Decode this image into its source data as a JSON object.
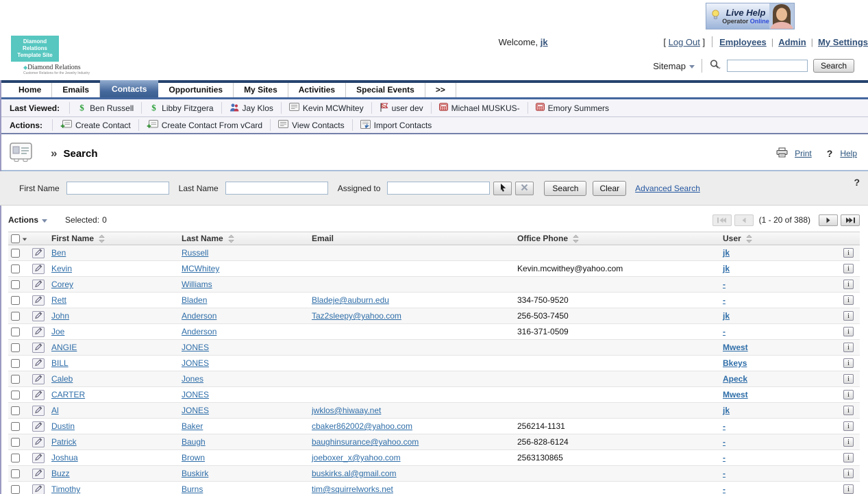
{
  "header": {
    "logo": {
      "line1": "Diamond Relations",
      "line2": "Template Site",
      "brand": "Diamond Relations",
      "tagline": "Customer Relations for the Jewelry Industry"
    },
    "live_help": {
      "title": "Live Help",
      "operator": "Operator",
      "status": "Online"
    },
    "welcome": {
      "prefix": "Welcome,",
      "user": "jk",
      "bracket_open": "[",
      "logout": "Log Out",
      "bracket_close": "]"
    },
    "links": [
      {
        "label": "Employees"
      },
      {
        "label": "Admin"
      },
      {
        "label": "My Settings"
      }
    ],
    "sitemap_label": "Sitemap",
    "site_search": {
      "value": "",
      "placeholder": "",
      "button": "Search"
    }
  },
  "nav": {
    "tabs": [
      {
        "label": "Home",
        "active": false
      },
      {
        "label": "Emails",
        "active": false
      },
      {
        "label": "Contacts",
        "active": true
      },
      {
        "label": "Opportunities",
        "active": false
      },
      {
        "label": "My Sites",
        "active": false
      },
      {
        "label": "Activities",
        "active": false
      },
      {
        "label": "Special Events",
        "active": false
      },
      {
        "label": ">>",
        "active": false
      }
    ]
  },
  "last_viewed": {
    "label": "Last Viewed:",
    "items": [
      {
        "label": "Ben Russell",
        "icon": "sugar-s-icon"
      },
      {
        "label": "Libby Fitzgera",
        "icon": "sugar-s-icon"
      },
      {
        "label": "Jay Klos",
        "icon": "people-icon"
      },
      {
        "label": "Kevin MCWhitey",
        "icon": "note-icon"
      },
      {
        "label": "user dev",
        "icon": "flag-icon"
      },
      {
        "label": "Michael MUSKUS-",
        "icon": "phone-icon"
      },
      {
        "label": "Emory Summers",
        "icon": "phone-icon"
      }
    ]
  },
  "actions_bar": {
    "label": "Actions:",
    "items": [
      {
        "label": "Create Contact",
        "icon": "card-plus-icon"
      },
      {
        "label": "Create Contact From vCard",
        "icon": "card-plus-icon"
      },
      {
        "label": "View Contacts",
        "icon": "note-icon"
      },
      {
        "label": "Import Contacts",
        "icon": "import-icon"
      }
    ]
  },
  "module": {
    "chevrons": "»",
    "title": "Search",
    "print_label": "Print",
    "help_label": "Help",
    "help_mark": "?"
  },
  "search_form": {
    "first_name_label": "First Name",
    "first_name_value": "",
    "last_name_label": "Last Name",
    "last_name_value": "",
    "assigned_to_label": "Assigned to",
    "assigned_to_value": "",
    "search_button": "Search",
    "clear_button": "Clear",
    "advanced_link": "Advanced Search",
    "help_mark": "?"
  },
  "list": {
    "actions_label": "Actions",
    "selected_label": "Selected:",
    "selected_count": "0",
    "pagination_text": "(1 - 20 of 388)"
  },
  "table": {
    "columns": [
      {
        "label": "First Name",
        "sortable": true
      },
      {
        "label": "Last Name",
        "sortable": true
      },
      {
        "label": "Email",
        "sortable": false
      },
      {
        "label": "Office Phone",
        "sortable": true
      },
      {
        "label": "User",
        "sortable": true
      }
    ],
    "rows": [
      {
        "first": "Ben",
        "last": "Russell",
        "email": "",
        "phone": "",
        "user": "jk"
      },
      {
        "first": "Kevin",
        "last": "MCWhitey",
        "email": "",
        "phone": "Kevin.mcwithey@yahoo.com",
        "user": "jk"
      },
      {
        "first": "Corey",
        "last": "Williams",
        "email": "",
        "phone": "",
        "user": "-"
      },
      {
        "first": "Rett",
        "last": "Bladen",
        "email": "Bladeje@auburn.edu",
        "phone": "334-750-9520",
        "user": "-"
      },
      {
        "first": "John",
        "last": "Anderson",
        "email": "Taz2sleepy@yahoo.com",
        "phone": "256-503-7450",
        "user": "jk"
      },
      {
        "first": "Joe",
        "last": "Anderson",
        "email": "",
        "phone": "316-371-0509",
        "user": "-"
      },
      {
        "first": "ANGIE",
        "last": "JONES",
        "email": "",
        "phone": "",
        "user": "Mwest"
      },
      {
        "first": "BILL",
        "last": "JONES",
        "email": "",
        "phone": "",
        "user": "Bkeys"
      },
      {
        "first": "Caleb",
        "last": "Jones",
        "email": "",
        "phone": "",
        "user": "Apeck"
      },
      {
        "first": "CARTER",
        "last": "JONES",
        "email": "",
        "phone": "",
        "user": "Mwest"
      },
      {
        "first": "Al",
        "last": "JONES",
        "email": "jwklos@hiwaay.net",
        "phone": "",
        "user": "jk"
      },
      {
        "first": "Dustin",
        "last": "Baker",
        "email": "cbaker862002@yahoo.com",
        "phone": "256214-1131",
        "user": "-"
      },
      {
        "first": "Patrick",
        "last": "Baugh",
        "email": "baughinsurance@yahoo.com",
        "phone": "256-828-6124",
        "user": "-"
      },
      {
        "first": "Joshua",
        "last": "Brown",
        "email": "joeboxer_x@yahoo.com",
        "phone": "2563130865",
        "user": "-"
      },
      {
        "first": "Buzz",
        "last": "Buskirk",
        "email": "buskirks.al@gmail.com",
        "phone": "",
        "user": "-"
      },
      {
        "first": "Timothy",
        "last": "Burns",
        "email": "tim@squirrelworks.net",
        "phone": "",
        "user": "-"
      }
    ]
  },
  "colors": {
    "nav_navy": "#26436e",
    "nav_active_blue": "#46699c",
    "link_blue": "#2e6da8",
    "bar_bg": "#f4f4f9",
    "form_bg": "#ededed",
    "logo_teal": "#57c7c0"
  }
}
